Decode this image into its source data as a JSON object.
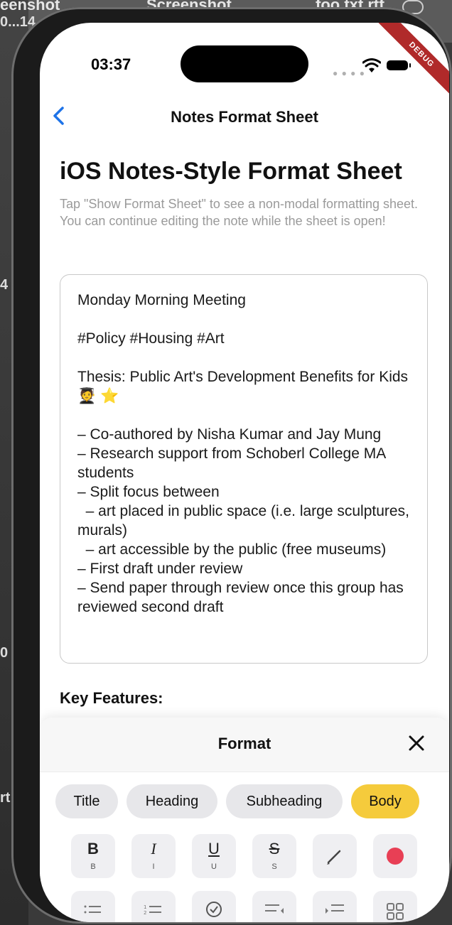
{
  "desktop": {
    "labels": [
      "eenshot",
      "0...14",
      "Screenshot",
      "foo.txt.rtf",
      "4",
      "0",
      "rt"
    ]
  },
  "status": {
    "time": "03:37",
    "debug": "DEBUG"
  },
  "nav": {
    "title": "Notes Format Sheet",
    "back_icon": "chevron-left-icon"
  },
  "content": {
    "title": "iOS Notes-Style Format Sheet",
    "subtitle": "Tap \"Show Format Sheet\" to see a non-modal formatting sheet. You can continue editing the note while the sheet is open!",
    "note": "Monday Morning Meeting\n\n#Policy #Housing #Art\n\nThesis: Public Art's Development Benefits for Kids 🧑‍🎓 ⭐\n\n– Co-authored by Nisha Kumar and Jay Mung\n– Research support from Schoberl College MA students\n– Split focus between\n  – art placed in public space (i.e. large sculptures, murals)\n  – art accessible by the public (free museums)\n– First draft under review\n– Send paper through review once this group has reviewed second draft",
    "key_features": "Key Features:"
  },
  "sheet": {
    "title": "Format",
    "styles": [
      "Title",
      "Heading",
      "Subheading",
      "Body"
    ],
    "active_style": "Body",
    "buttons": [
      {
        "glyph": "B",
        "label": "B"
      },
      {
        "glyph": "I",
        "label": "I"
      },
      {
        "glyph": "U",
        "label": "U"
      },
      {
        "glyph": "S",
        "label": "S"
      }
    ],
    "accent_color": "#f5cb3c",
    "record_color": "#e83f55"
  }
}
